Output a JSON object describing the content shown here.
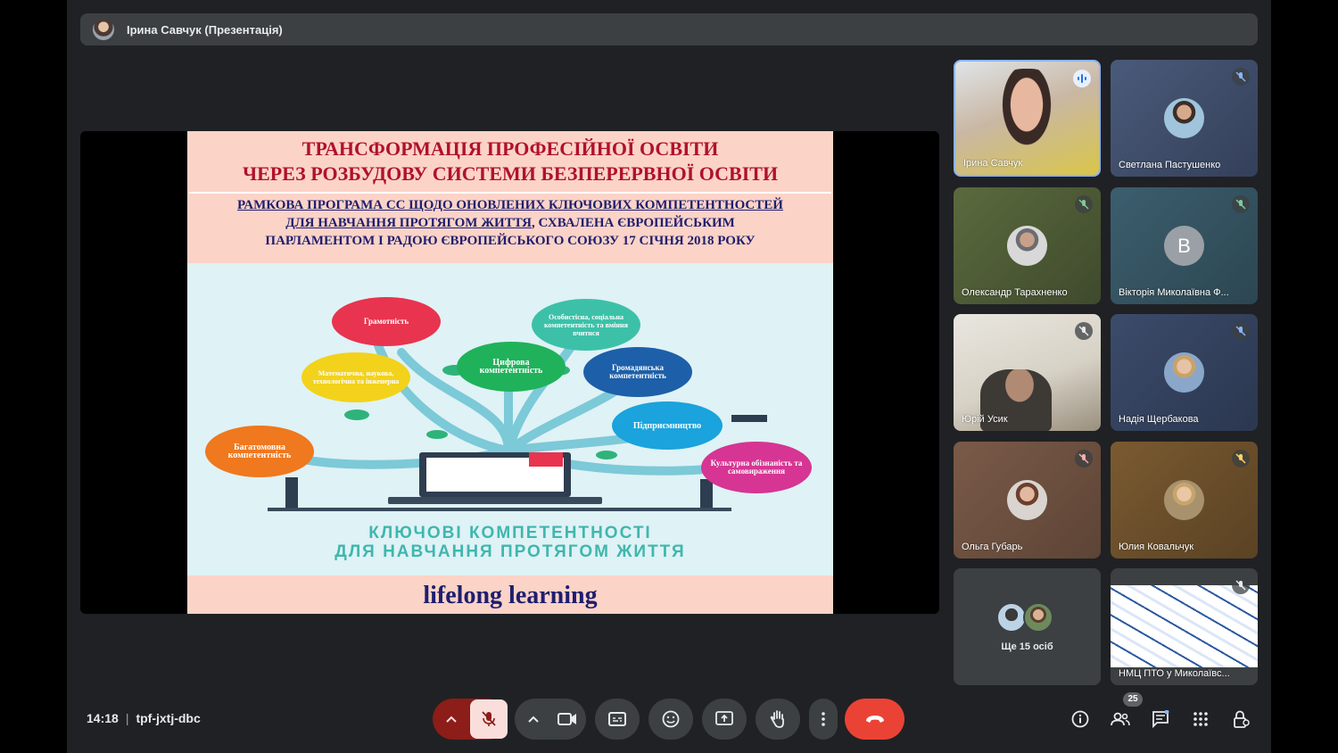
{
  "presenter": {
    "name": "Ірина Савчук (Презентація)"
  },
  "slide": {
    "title_line1": "ТРАНСФОРМАЦІЯ ПРОФЕСІЙНОЇ ОСВІТИ",
    "title_line2": "ЧЕРЕЗ РОЗБУДОВУ СИСТЕМИ БЕЗПЕРЕРВНОЇ ОСВІТИ",
    "subtitle_line1": "РАМКОВА ПРОГРАМА СС ЩОДО ОНОВЛЕНИХ КЛЮЧОВИХ КОМПЕТЕНТНОСТЕЙ",
    "subtitle_line2a": "ДЛЯ НАВЧАННЯ ПРОТЯГОМ ЖИТТЯ",
    "subtitle_line2b": ", СХВАЛЕНА ЄВРОПЕЙСЬКИМ",
    "subtitle_line3": "ПАРЛАМЕНТОМ І РАДОЮ ЄВРОПЕЙСЬКОГО СОЮЗУ 17 СІЧНЯ 2018 РОКУ",
    "competences": [
      {
        "label": "Грамотність",
        "color": "#e8344e"
      },
      {
        "label": "Особистісна, соціальна компетентність та вміння вчитися",
        "color": "#3cc1a8"
      },
      {
        "label": "Математична, наукова, технологічна та інженерна",
        "color": "#f2d21b"
      },
      {
        "label": "Цифрова компетентність",
        "color": "#1fb25a"
      },
      {
        "label": "Громадянська компетентність",
        "color": "#1d5fa8"
      },
      {
        "label": "Підприємництво",
        "color": "#1aa3dc"
      },
      {
        "label": "Багатомовна компетентність",
        "color": "#f0781e"
      },
      {
        "label": "Культурна обізнаність та самовираження",
        "color": "#d63593"
      }
    ],
    "caption_line1": "КЛЮЧОВІ КОМПЕТЕНТНОСТІ",
    "caption_line2": "ДЛЯ НАВЧАННЯ ПРОТЯГОМ ЖИТТЯ",
    "footer": "lifelong learning"
  },
  "participants": [
    {
      "name": "Ірина Савчук",
      "status": "speaking"
    },
    {
      "name": "Светлана Пастушенко",
      "status": "muted"
    },
    {
      "name": "Олександр Тарахненко",
      "status": "muted"
    },
    {
      "name": "Вікторія Миколаївна Ф...",
      "status": "muted",
      "initial": "В"
    },
    {
      "name": "Юрій Усик",
      "status": "muted"
    },
    {
      "name": "Надія Щербакова",
      "status": "muted"
    },
    {
      "name": "Ольга Губарь",
      "status": "muted"
    },
    {
      "name": "Юлия Ковальчук",
      "status": "muted"
    },
    {
      "name": "НМЦ ПТО у Миколаївс...",
      "status": "muted"
    }
  ],
  "others": {
    "label": "Ще 15 осіб"
  },
  "meeting": {
    "time": "14:18",
    "code": "tpf-jxtj-dbc"
  },
  "people_count": "25",
  "colors": {
    "end_call": "#ea4335",
    "mic_off": "#f9dedc",
    "mic_off_bg": "#8c1d18",
    "background": "#202124"
  }
}
